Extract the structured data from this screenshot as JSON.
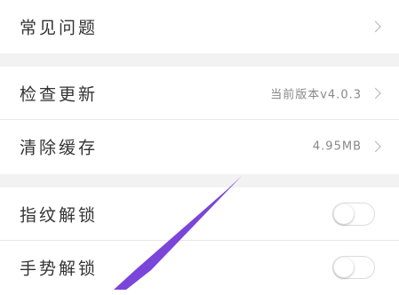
{
  "settings": {
    "faq": {
      "label": "常见问题"
    },
    "check_update": {
      "label": "检查更新",
      "value": "当前版本v4.0.3"
    },
    "clear_cache": {
      "label": "清除缓存",
      "value": "4.95MB"
    },
    "fingerprint_unlock": {
      "label": "指纹解锁",
      "enabled": false
    },
    "gesture_unlock": {
      "label": "手势解锁",
      "enabled": false
    }
  },
  "annotation": {
    "arrow_color": "#7a45d8"
  }
}
